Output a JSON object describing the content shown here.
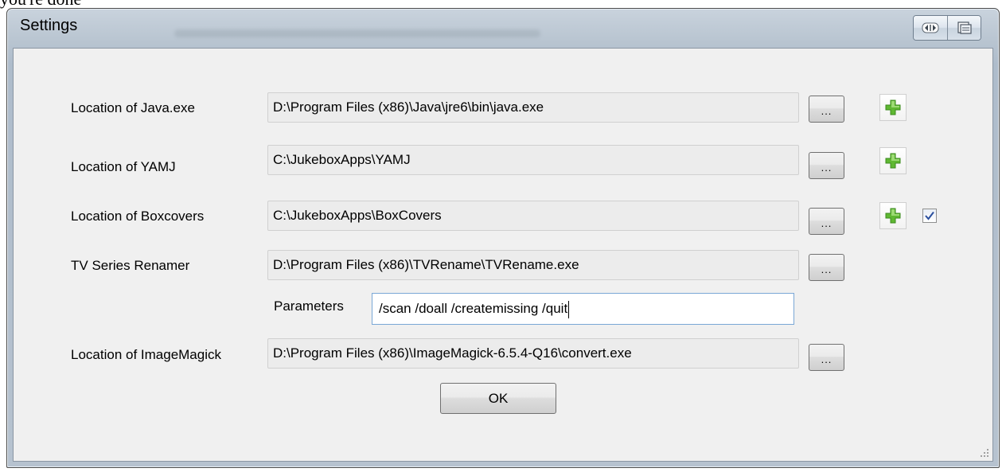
{
  "top_caption": "you're done",
  "window": {
    "title": "Settings",
    "icons": [
      "snap-icon",
      "restore-icon"
    ]
  },
  "fields": {
    "java": {
      "label": "Location of Java.exe",
      "value": "D:\\Program Files (x86)\\Java\\jre6\\bin\\java.exe",
      "browse_label": "..."
    },
    "yamj": {
      "label": "Location of YAMJ",
      "value": "C:\\JukeboxApps\\YAMJ",
      "browse_label": "..."
    },
    "boxcovers": {
      "label": "Location of Boxcovers",
      "value": "C:\\JukeboxApps\\BoxCovers",
      "browse_label": "...",
      "checkbox_checked": true
    },
    "tvrenamer": {
      "label": "TV Series Renamer",
      "value": "D:\\Program Files (x86)\\TVRename\\TVRename.exe",
      "browse_label": "..."
    },
    "parameters": {
      "label": "Parameters",
      "value": "/scan /doall /createmissing /quit"
    },
    "imagemagick": {
      "label": "Location of ImageMagick",
      "value": "D:\\Program Files (x86)\\ImageMagick-6.5.4-Q16\\convert.exe",
      "browse_label": "..."
    }
  },
  "ok_label": "OK",
  "colors": {
    "add_icon_green": "#5fb832",
    "checkbox_check": "#2b4f9e",
    "input_focus_border": "#7aa7d6"
  }
}
